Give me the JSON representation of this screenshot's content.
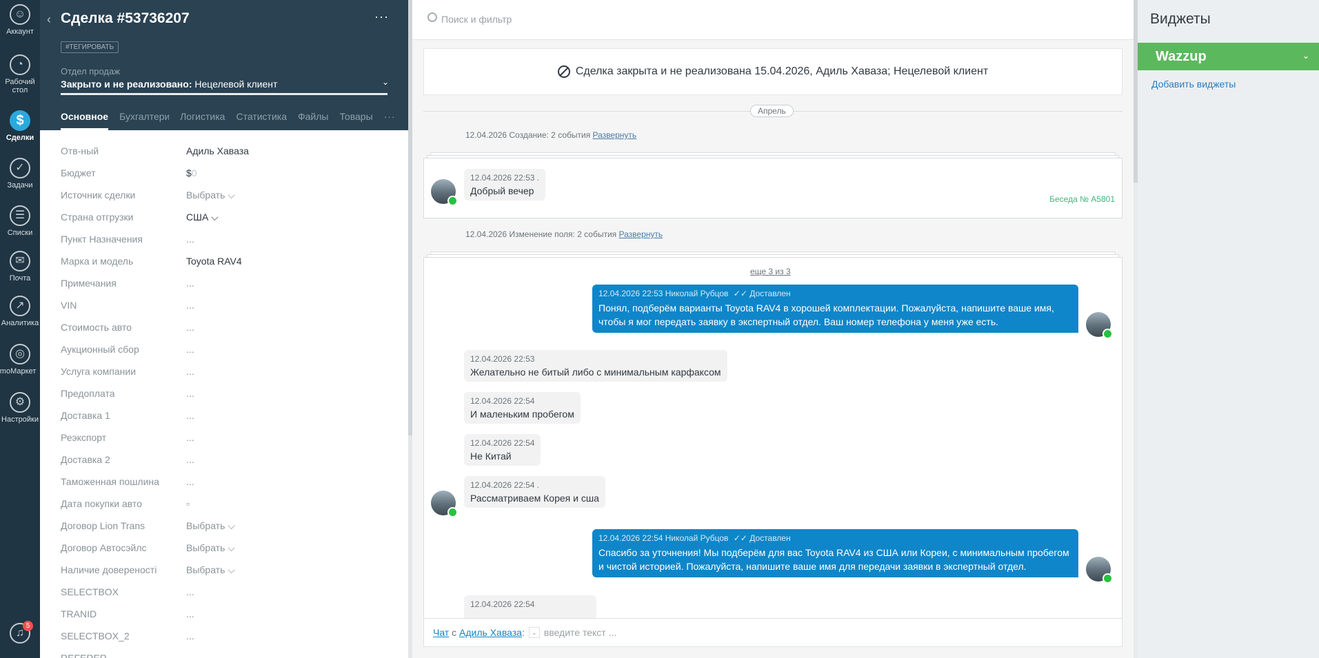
{
  "nav": {
    "items": [
      {
        "label": "Аккаунт",
        "icon": "user-icon"
      },
      {
        "label": "Рабочий стол",
        "icon": "dashboard-icon"
      },
      {
        "label": "Сделки",
        "icon": "deals-icon"
      },
      {
        "label": "Задачи",
        "icon": "tasks-icon"
      },
      {
        "label": "Списки",
        "icon": "lists-icon"
      },
      {
        "label": "Почта",
        "icon": "mail-icon"
      },
      {
        "label": "Аналитика",
        "icon": "analytics-icon"
      },
      {
        "label": "amoМаркет",
        "icon": "market-icon"
      },
      {
        "label": "Настройки",
        "icon": "settings-icon"
      }
    ],
    "notifications_badge": "5",
    "active_color": "#2aa9df"
  },
  "card": {
    "title": "Сделка #53736207",
    "more": "···",
    "tag_button": "#ТЕГИРОВАТЬ",
    "pipeline": "Отдел продаж",
    "status_bold": "Закрыто и не реализовано:",
    "status_reason": " Нецелевой клиент",
    "tabs": [
      "Основное",
      "Бухгалтерия",
      "Логистика",
      "Статистика",
      "Файлы",
      "Товары",
      "···"
    ],
    "fields": [
      {
        "label": "Отв-ный",
        "value": "Адиль Хаваза"
      },
      {
        "label": "Бюджет",
        "value": "$",
        "zero": "0"
      },
      {
        "label": "Источник сделки",
        "value": "Выбрать ⌵"
      },
      {
        "label": "Страна отгрузки",
        "value": "США ⌵"
      },
      {
        "label": "Пункт Назначения",
        "value": "..."
      },
      {
        "label": "Марка и модель",
        "value": "Toyota RAV4"
      },
      {
        "label": "Примечания",
        "value": "..."
      },
      {
        "label": "VIN",
        "value": "..."
      },
      {
        "label": "Стоимость авто",
        "value": "..."
      },
      {
        "label": "Аукционный сбор",
        "value": "..."
      },
      {
        "label": "Услуга компании",
        "value": "..."
      },
      {
        "label": "Предоплата",
        "value": "..."
      },
      {
        "label": "Доставка 1",
        "value": "..."
      },
      {
        "label": "Реэкспорт",
        "value": "..."
      },
      {
        "label": "Доставка 2",
        "value": "..."
      },
      {
        "label": "Таможенная пошлина",
        "value": "..."
      },
      {
        "label": "Дата покупки авто",
        "value": "▫"
      },
      {
        "label": "Договор Lion Trans",
        "value": "Выбрать ⌵"
      },
      {
        "label": "Договор Автосэйлс",
        "value": "Выбрать ⌵"
      },
      {
        "label": "Наличие довереності",
        "value": "Выбрать ⌵"
      },
      {
        "label": "SELECTBOX",
        "value": "..."
      },
      {
        "label": "TRANID",
        "value": "..."
      },
      {
        "label": "SELECTBOX_2",
        "value": "..."
      },
      {
        "label": "REFERER",
        "value": ""
      }
    ]
  },
  "feed": {
    "search_placeholder": "Поиск и фильтр",
    "closed_notice": "Сделка закрыта и не реализована 15.04.2026, Адиль Хаваза; Нецелевой клиент",
    "month": "Апрель",
    "group1": {
      "text": "12.04.2026 Создание: 2 события ",
      "link": "Развернуть"
    },
    "group2": {
      "text": "12.04.2026 Изменение поля: 2 события ",
      "link": "Развернуть"
    },
    "msg1": {
      "meta": "12.04.2026 22:53 .",
      "text": "Добрый вечер"
    },
    "conv_no": "Беседа № A5801",
    "more_link": "еще 3 из 3",
    "out1": {
      "meta": "12.04.2026 22:53 Николай Рубцов",
      "delivered": "✓✓ Доставлен",
      "line1": "Понял, подберём варианты Toyota RAV4 в хорошей комплектации. Пожалуйста, напишите ваше имя,",
      "line2": "чтобы я мог передать заявку в экспертный отдел. Ваш номер телефона у меня уже есть."
    },
    "in2": {
      "meta": "12.04.2026 22:53",
      "text": "Желательно не битый либо с минимальным карфаксом"
    },
    "in3": {
      "meta": "12.04.2026 22:54",
      "text": "И маленьким пробегом"
    },
    "in4": {
      "meta": "12.04.2026 22:54",
      "text": "Не Китай"
    },
    "in5": {
      "meta": "12.04.2026 22:54 .",
      "text": "Рассматриваем Корея и сша"
    },
    "out2": {
      "meta": "12.04.2026 22:54 Николай Рубцов",
      "delivered": "✓✓ Доставлен",
      "line1": "Спасибо за уточнения! Мы подберём для вас Toyota RAV4 из США или Кореи, с минимальным пробегом",
      "line2": "и чистой историей. Пожалуйста, напишите ваше имя для передачи заявки в экспертный отдел."
    },
    "in6": {
      "meta": "12.04.2026 22:54",
      "text": ""
    },
    "composer": {
      "chat": "Чат",
      "with": " с ",
      "contact": "Адиль Хаваза",
      "colon": ":",
      "placeholder": "введите текст ..."
    },
    "outgoing_color": "#0f86c9",
    "whatsapp_color": "#27c13f"
  },
  "widgets": {
    "title": "Виджеты",
    "wazzup": "Wazzup",
    "add": "Добавить виджеты",
    "wazzup_color": "#5cb85c"
  }
}
